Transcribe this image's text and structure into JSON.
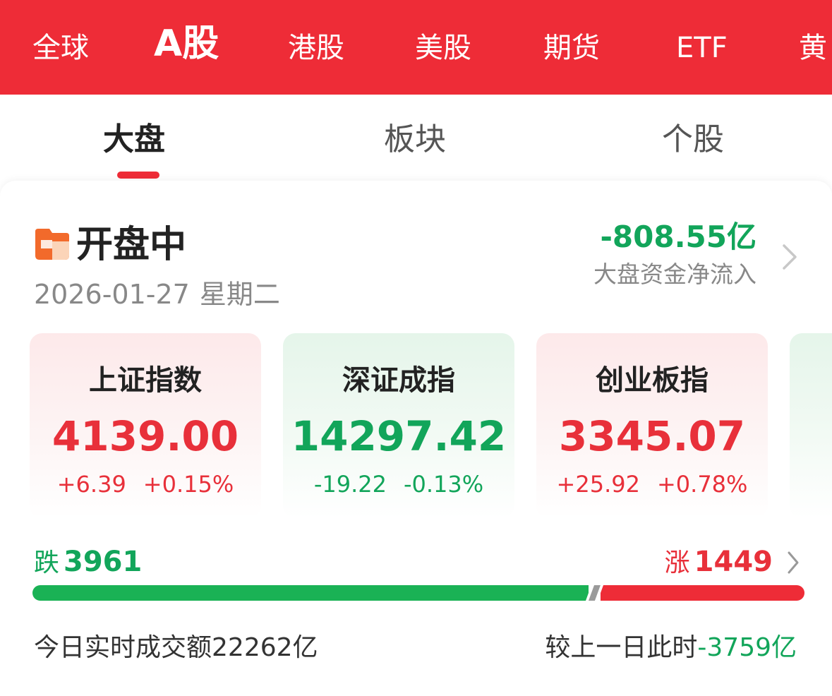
{
  "colors": {
    "brand_red": "#ee2c37",
    "up_red": "#e8303a",
    "down_green": "#12a55a",
    "flat_gray": "#9a9a9a"
  },
  "market_tabs": [
    {
      "label": "全球",
      "active": false
    },
    {
      "label": "A股",
      "active": true
    },
    {
      "label": "港股",
      "active": false
    },
    {
      "label": "美股",
      "active": false
    },
    {
      "label": "期货",
      "active": false
    },
    {
      "label": "ETF",
      "active": false
    },
    {
      "label": "黄",
      "active": false
    }
  ],
  "sub_tabs": [
    {
      "label": "大盘",
      "active": true
    },
    {
      "label": "板块",
      "active": false
    },
    {
      "label": "个股",
      "active": false
    }
  ],
  "status": {
    "icon": "market-open-icon",
    "title": "开盘中",
    "date": "2026-01-27",
    "weekday": "星期二"
  },
  "fund_flow": {
    "value": "-808.55亿",
    "label": "大盘资金净流入",
    "icon": "chevron-right-icon"
  },
  "indices": [
    {
      "name": "上证指数",
      "price": "4139.00",
      "change": "+6.39",
      "percent": "+0.15%",
      "direction": "up"
    },
    {
      "name": "深证成指",
      "price": "14297.42",
      "change": "-19.22",
      "percent": "-0.13%",
      "direction": "down"
    },
    {
      "name": "创业板指",
      "price": "3345.07",
      "change": "+25.92",
      "percent": "+0.78%",
      "direction": "up"
    }
  ],
  "breadth": {
    "fall_label": "跌",
    "fall_count": "3961",
    "rise_label": "涨",
    "rise_count": "1449",
    "fall_ratio": 0.726,
    "flat_ratio": 0.008,
    "rise_ratio": 0.266
  },
  "turnover": {
    "label": "今日实时成交额",
    "value": "22262亿",
    "compare_label": "较上一日此时",
    "compare_value": "-3759亿"
  }
}
